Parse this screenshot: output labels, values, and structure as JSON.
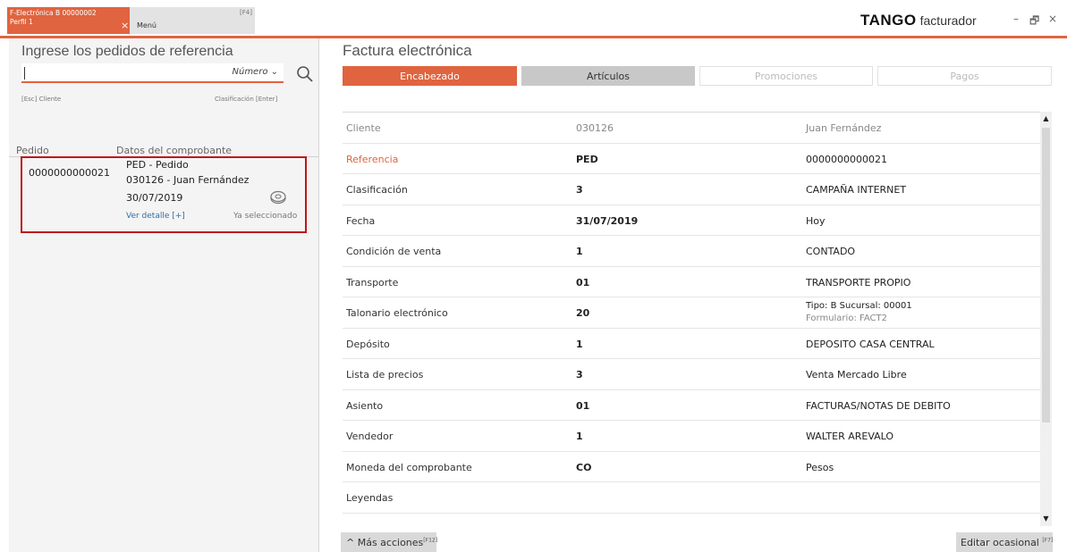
{
  "tabs": {
    "active": {
      "line1": "F-Electrónica B 00000002",
      "line2": "Perfil 1",
      "close": "×"
    },
    "menu": {
      "label": "Menú",
      "shortcut": "[F4]"
    }
  },
  "brand": {
    "name": "TANGO",
    "product": "facturador"
  },
  "window_controls": {
    "minimize": "–",
    "restore": "🗗",
    "close": "×"
  },
  "left": {
    "title": "Ingrese los pedidos de referencia",
    "search": {
      "value": "",
      "mode": "Número ⌄"
    },
    "hint_left": "[Esc] Cliente",
    "hint_right": "Clasificación [Enter]",
    "columns": {
      "pedido": "Pedido",
      "datos": "Datos del comprobante"
    },
    "order": {
      "number": "0000000000021",
      "line1": "PED - Pedido",
      "line2": "030126 - Juan Fernández",
      "date": "30/07/2019",
      "detail_link": "Ver detalle [+]",
      "status": "Ya seleccionado"
    }
  },
  "right": {
    "title": "Factura electrónica",
    "tabs": [
      "Encabezado",
      "Artículos",
      "Promociones",
      "Pagos"
    ],
    "rows": [
      {
        "label": "Cliente",
        "code": "030126",
        "desc": "Juan Fernández"
      },
      {
        "label": "Referencia",
        "code": "PED",
        "desc": "0000000000021"
      },
      {
        "label": "Clasificación",
        "code": "3",
        "desc": "CAMPAÑA INTERNET"
      },
      {
        "label": "Fecha",
        "code": "31/07/2019",
        "desc": "Hoy"
      },
      {
        "label": "Condición de venta",
        "code": "1",
        "desc": "CONTADO"
      },
      {
        "label": "Transporte",
        "code": "01",
        "desc": "TRANSPORTE PROPIO"
      },
      {
        "label": "Talonario electrónico",
        "code": "20",
        "desc": "Tipo: B   Sucursal: 00001",
        "desc2": "Formulario: FACT2"
      },
      {
        "label": "Depósito",
        "code": "1",
        "desc": "DEPOSITO CASA CENTRAL"
      },
      {
        "label": "Lista de precios",
        "code": "3",
        "desc": "Venta Mercado Libre"
      },
      {
        "label": "Asiento",
        "code": "01",
        "desc": "FACTURAS/NOTAS DE DEBITO"
      },
      {
        "label": "Vendedor",
        "code": "1",
        "desc": "WALTER AREVALO"
      },
      {
        "label": "Moneda del comprobante",
        "code": "CO",
        "desc": "Pesos"
      },
      {
        "label": "Leyendas",
        "code": "",
        "desc": ""
      }
    ],
    "more_actions": {
      "label": "Más acciones",
      "shortcut": "[F12]"
    },
    "edit_occasional": {
      "label": "Editar ocasional",
      "shortcut": "[F7]"
    }
  },
  "colors": {
    "accent": "#e0643f",
    "highlight_border": "#c0141b",
    "link": "#2f6ea6"
  }
}
